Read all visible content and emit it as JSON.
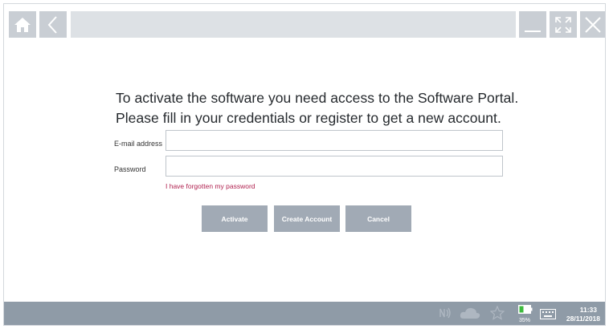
{
  "window": {
    "title_field": ""
  },
  "form": {
    "headline_line1": "To activate the software you need access to the Software Portal.",
    "headline_line2": "Please fill in your credentials or register to get a new account.",
    "email_label": "E-mail address",
    "email_value": "",
    "password_label": "Password",
    "password_value": "",
    "forgot_link": "I have forgotten my password"
  },
  "buttons": {
    "activate": "Activate",
    "create_account": "Create Account",
    "cancel": "Cancel"
  },
  "taskbar": {
    "battery_percent": "35%",
    "time": "11:33",
    "date": "28/11/2018"
  },
  "colors": {
    "link": "#b0214f",
    "button_bg": "#a1aab5",
    "taskbar_bg": "#8f9ba7",
    "battery_green": "#3dbb3d"
  }
}
